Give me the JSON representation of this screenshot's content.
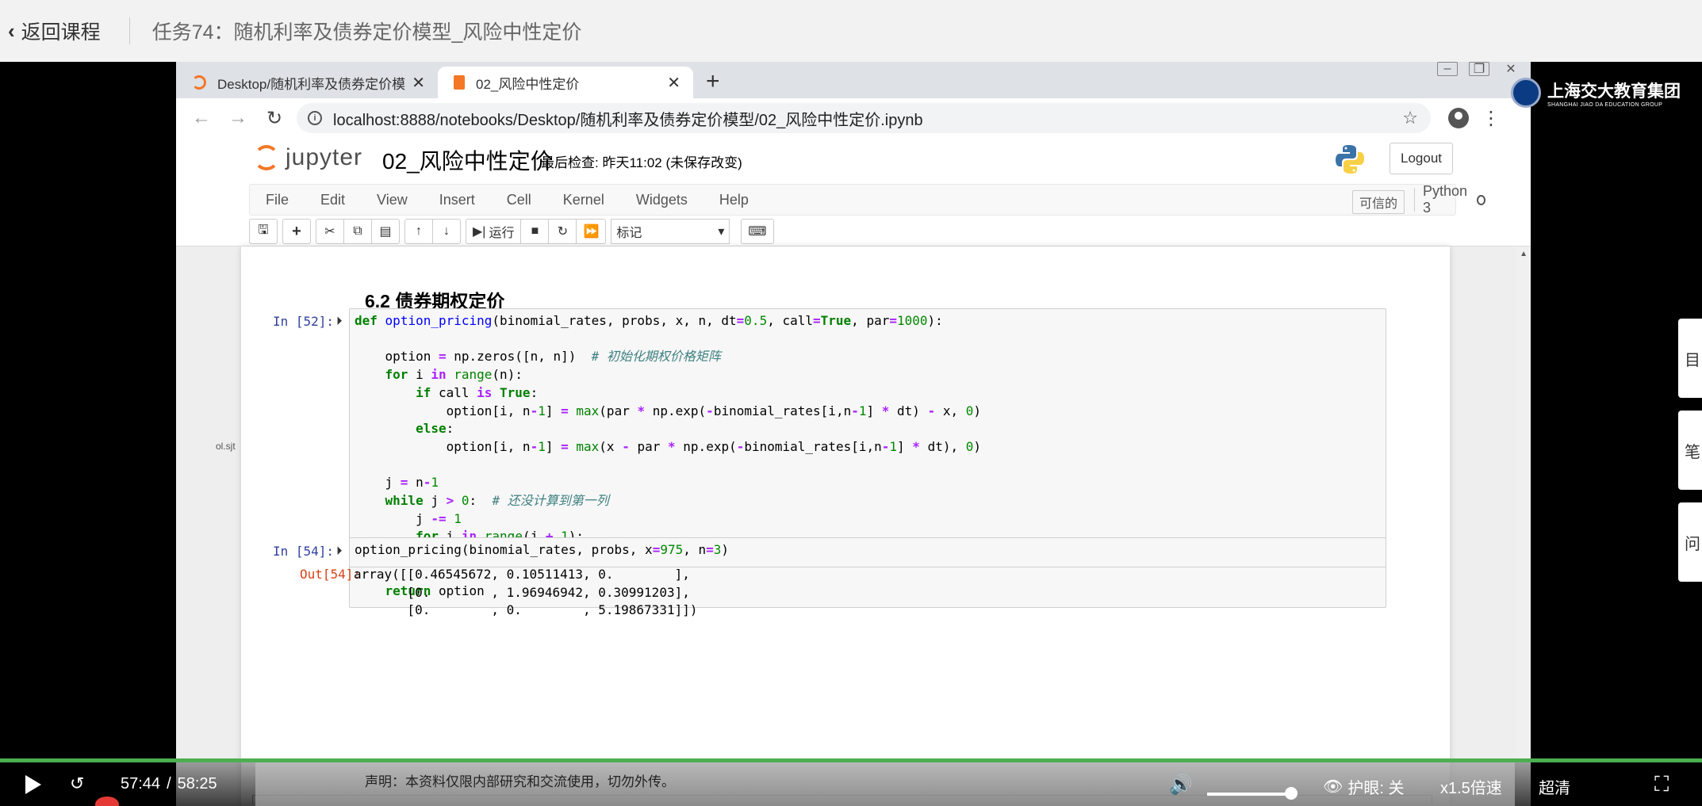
{
  "course_bar": {
    "back_label": "返回课程",
    "title": "任务74：随机利率及债券定价模型_风险中性定价"
  },
  "browser": {
    "tabs": [
      {
        "label": "Desktop/随机利率及债券定价模",
        "icon": "jupyter-icon",
        "active": false
      },
      {
        "label": "02_风险中性定价",
        "icon": "notebook-icon",
        "active": true
      }
    ],
    "url": "localhost:8888/notebooks/Desktop/随机利率及债券定价模型/02_风险中性定价.ipynb"
  },
  "jupyter": {
    "logo_text": "jupyter",
    "notebook_name": "02_风险中性定价",
    "checkpoint": "最后检查: 昨天11:02  (未保存改变)",
    "logout_label": "Logout",
    "menu": [
      "File",
      "Edit",
      "View",
      "Insert",
      "Cell",
      "Kernel",
      "Widgets",
      "Help"
    ],
    "trusted_label": "可信的",
    "kernel_name": "Python 3",
    "run_label": "运行",
    "cell_type": "标记"
  },
  "notebook": {
    "heading": "6.2 债券期权定价",
    "cells": [
      {
        "prompt": "In  [52]:"
      },
      {
        "prompt": "In  [54]:"
      }
    ],
    "out_prompt": "Out[54]:",
    "output_lines": [
      "array([[0.46545672, 0.10511413, 0.        ],",
      "       [0.        , 1.96946942, 0.30991203],",
      "       [0.        , 0.        , 5.19867331]])"
    ]
  },
  "brand": {
    "name": "上海交大教育集团",
    "sub": "SHANGHAI JIAO DA EDUCATION GROUP"
  },
  "side_cards": [
    "目",
    "笔",
    "问"
  ],
  "ghost_text": "ol.sjt",
  "player": {
    "current_time": "57:44",
    "separator": "/",
    "duration": "58:25",
    "progress": 0.988,
    "volume": 0.95,
    "notice": "声明：本资料仅限内部研究和交流使用，切勿外传。",
    "eye_care": "护眼: 关",
    "speed": "x1.5倍速",
    "quality": "超清"
  },
  "colors": {
    "progress": "#4caf50",
    "jupyter_orange": "#f37726",
    "prompt_in": "#303f9f",
    "prompt_out": "#d84315"
  }
}
